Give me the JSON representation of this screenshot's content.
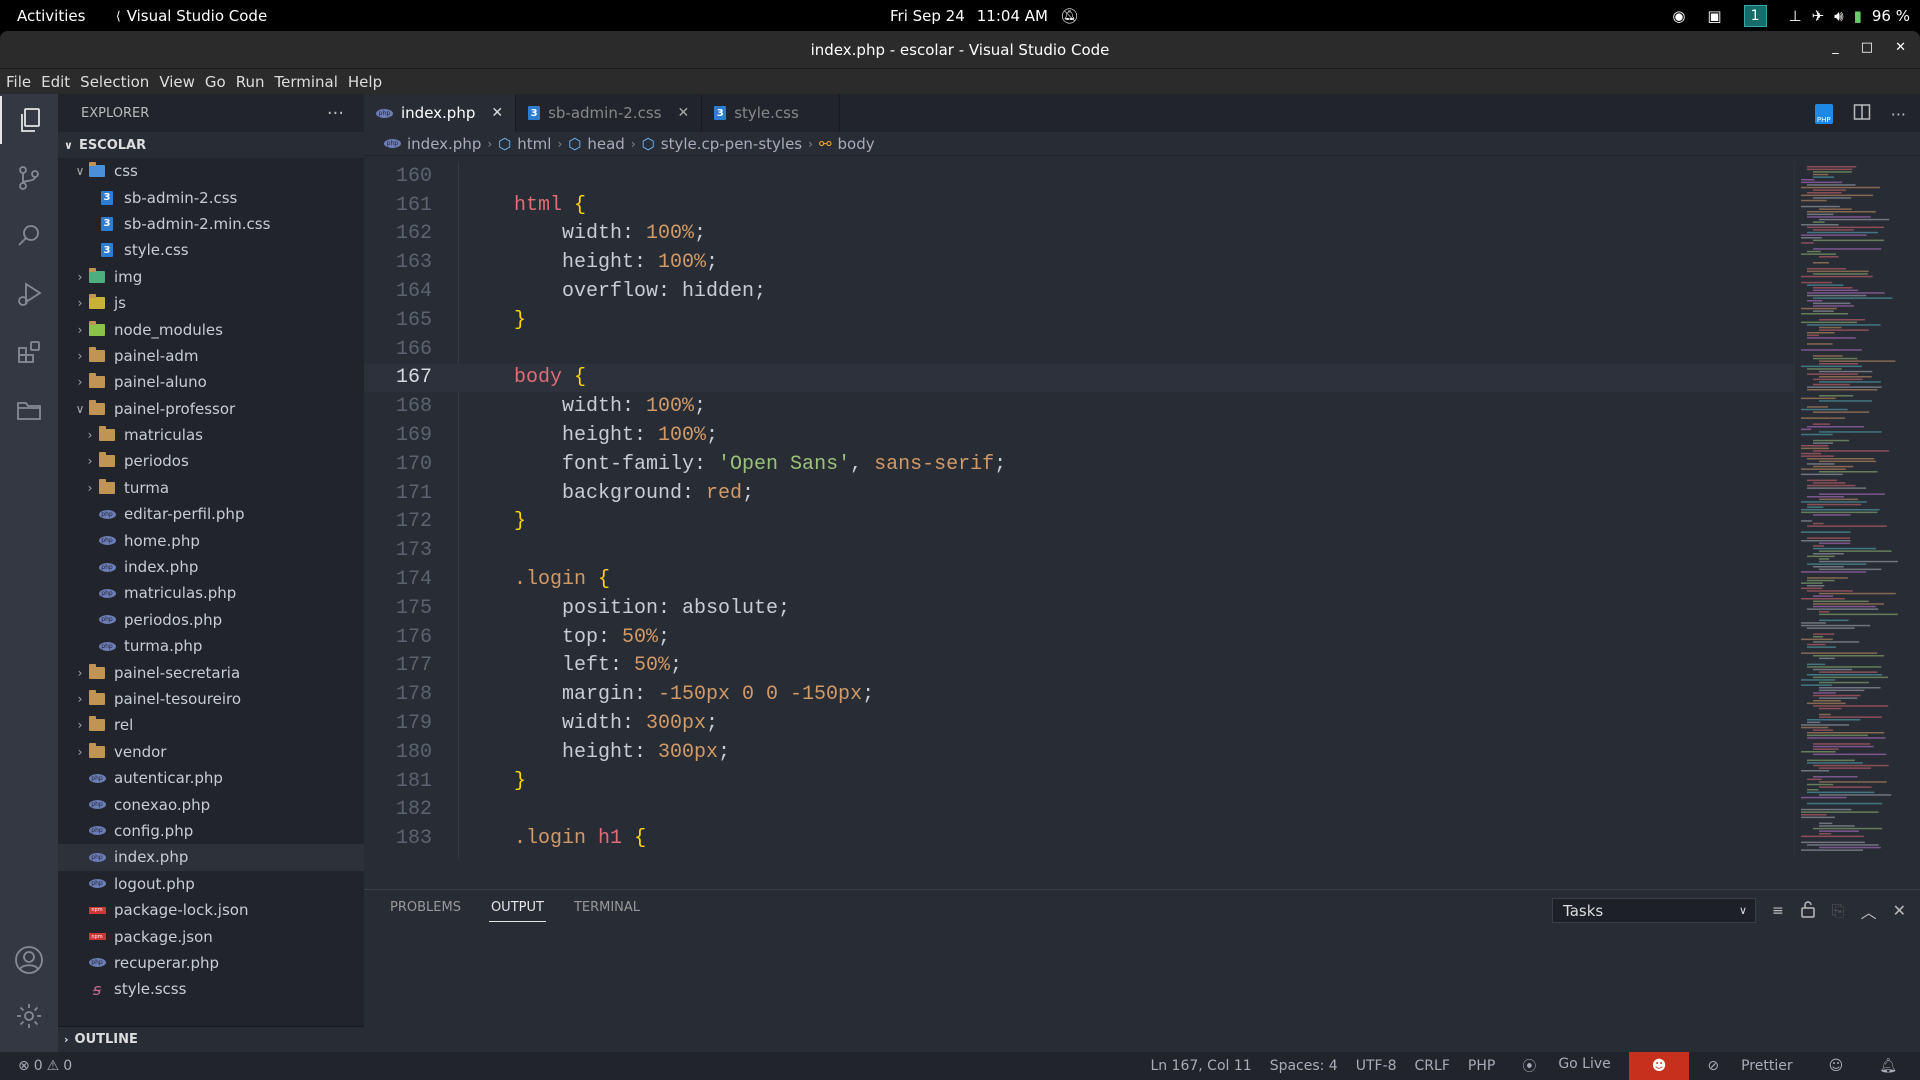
{
  "topbar": {
    "activities": "Activities",
    "app_name": "Visual Studio Code",
    "date": "Fri Sep 24",
    "time": "11:04 AM",
    "workspace": "1",
    "battery": "96 %"
  },
  "window": {
    "title": "index.php - escolar - Visual Studio Code",
    "controls": {
      "minimize": "_",
      "maximize": "□",
      "close": "✕"
    }
  },
  "menu": [
    "File",
    "Edit",
    "Selection",
    "View",
    "Go",
    "Run",
    "Terminal",
    "Help"
  ],
  "explorer": {
    "title": "EXPLORER",
    "more": "···",
    "root": "ESCOLAR",
    "outline": "OUTLINE",
    "tree": [
      {
        "label": "css",
        "type": "css-folder",
        "depth": 1,
        "expanded": true
      },
      {
        "label": "sb-admin-2.css",
        "type": "css",
        "depth": 2
      },
      {
        "label": "sb-admin-2.min.css",
        "type": "css",
        "depth": 2
      },
      {
        "label": "style.css",
        "type": "css",
        "depth": 2
      },
      {
        "label": "img",
        "type": "folder",
        "depth": 1,
        "expanded": false
      },
      {
        "label": "js",
        "type": "folder",
        "depth": 1,
        "expanded": false
      },
      {
        "label": "node_modules",
        "type": "folder",
        "depth": 1,
        "expanded": false
      },
      {
        "label": "painel-adm",
        "type": "folder",
        "depth": 1,
        "expanded": false
      },
      {
        "label": "painel-aluno",
        "type": "folder",
        "depth": 1,
        "expanded": false
      },
      {
        "label": "painel-professor",
        "type": "folder",
        "depth": 1,
        "expanded": true
      },
      {
        "label": "matriculas",
        "type": "folder",
        "depth": 2,
        "expanded": false
      },
      {
        "label": "periodos",
        "type": "folder",
        "depth": 2,
        "expanded": false
      },
      {
        "label": "turma",
        "type": "folder",
        "depth": 2,
        "expanded": false
      },
      {
        "label": "editar-perfil.php",
        "type": "php",
        "depth": 2
      },
      {
        "label": "home.php",
        "type": "php",
        "depth": 2
      },
      {
        "label": "index.php",
        "type": "php",
        "depth": 2
      },
      {
        "label": "matriculas.php",
        "type": "php",
        "depth": 2
      },
      {
        "label": "periodos.php",
        "type": "php",
        "depth": 2
      },
      {
        "label": "turma.php",
        "type": "php",
        "depth": 2
      },
      {
        "label": "painel-secretaria",
        "type": "folder",
        "depth": 1,
        "expanded": false
      },
      {
        "label": "painel-tesoureiro",
        "type": "folder",
        "depth": 1,
        "expanded": false
      },
      {
        "label": "rel",
        "type": "folder",
        "depth": 1,
        "expanded": false
      },
      {
        "label": "vendor",
        "type": "folder",
        "depth": 1,
        "expanded": false
      },
      {
        "label": "autenticar.php",
        "type": "php",
        "depth": 1
      },
      {
        "label": "conexao.php",
        "type": "php",
        "depth": 1
      },
      {
        "label": "config.php",
        "type": "php",
        "depth": 1
      },
      {
        "label": "index.php",
        "type": "php",
        "depth": 1,
        "selected": true
      },
      {
        "label": "logout.php",
        "type": "php",
        "depth": 1
      },
      {
        "label": "package-lock.json",
        "type": "npm",
        "depth": 1
      },
      {
        "label": "package.json",
        "type": "npm",
        "depth": 1
      },
      {
        "label": "recuperar.php",
        "type": "php",
        "depth": 1
      },
      {
        "label": "style.scss",
        "type": "scss",
        "depth": 1
      }
    ]
  },
  "tabs": [
    {
      "label": "index.php",
      "type": "php",
      "active": true,
      "close": "✕"
    },
    {
      "label": "sb-admin-2.css",
      "type": "css",
      "active": false,
      "close": "✕"
    },
    {
      "label": "style.css",
      "type": "css",
      "active": false,
      "close": ""
    }
  ],
  "breadcrumb": [
    "index.php",
    "html",
    "head",
    "style.cp-pen-styles",
    "body"
  ],
  "code": {
    "current_line": 167,
    "lines": [
      {
        "n": "160",
        "tokens": []
      },
      {
        "n": "161",
        "tokens": [
          [
            "sel",
            "html"
          ],
          [
            "p",
            " "
          ],
          [
            "b",
            "{"
          ]
        ]
      },
      {
        "n": "162",
        "tokens": [
          [
            "p",
            "    width: "
          ],
          [
            "num",
            "100%"
          ],
          [
            "p",
            ";"
          ]
        ]
      },
      {
        "n": "163",
        "tokens": [
          [
            "p",
            "    height: "
          ],
          [
            "num",
            "100%"
          ],
          [
            "p",
            ";"
          ]
        ]
      },
      {
        "n": "164",
        "tokens": [
          [
            "p",
            "    overflow: hidden;"
          ]
        ]
      },
      {
        "n": "165",
        "tokens": [
          [
            "b",
            "}"
          ]
        ]
      },
      {
        "n": "166",
        "tokens": []
      },
      {
        "n": "167",
        "tokens": [
          [
            "sel",
            "body"
          ],
          [
            "p",
            " "
          ],
          [
            "b",
            "{"
          ]
        ]
      },
      {
        "n": "168",
        "tokens": [
          [
            "p",
            "    width: "
          ],
          [
            "num",
            "100%"
          ],
          [
            "p",
            ";"
          ]
        ]
      },
      {
        "n": "169",
        "tokens": [
          [
            "p",
            "    height: "
          ],
          [
            "num",
            "100%"
          ],
          [
            "p",
            ";"
          ]
        ]
      },
      {
        "n": "170",
        "tokens": [
          [
            "p",
            "    font-family: "
          ],
          [
            "str",
            "'Open Sans'"
          ],
          [
            "p",
            ", "
          ],
          [
            "num",
            "sans-serif"
          ],
          [
            "p",
            ";"
          ]
        ]
      },
      {
        "n": "171",
        "tokens": [
          [
            "p",
            "    background: "
          ],
          [
            "num",
            "red"
          ],
          [
            "p",
            ";"
          ]
        ]
      },
      {
        "n": "172",
        "tokens": [
          [
            "b",
            "}"
          ]
        ]
      },
      {
        "n": "173",
        "tokens": []
      },
      {
        "n": "174",
        "tokens": [
          [
            "cls",
            ".login"
          ],
          [
            "p",
            " "
          ],
          [
            "b",
            "{"
          ]
        ]
      },
      {
        "n": "175",
        "tokens": [
          [
            "p",
            "    position: absolute;"
          ]
        ]
      },
      {
        "n": "176",
        "tokens": [
          [
            "p",
            "    top: "
          ],
          [
            "num",
            "50%"
          ],
          [
            "p",
            ";"
          ]
        ]
      },
      {
        "n": "177",
        "tokens": [
          [
            "p",
            "    left: "
          ],
          [
            "num",
            "50%"
          ],
          [
            "p",
            ";"
          ]
        ]
      },
      {
        "n": "178",
        "tokens": [
          [
            "p",
            "    margin: "
          ],
          [
            "num",
            "-150px 0 0 -150px"
          ],
          [
            "p",
            ";"
          ]
        ]
      },
      {
        "n": "179",
        "tokens": [
          [
            "p",
            "    width: "
          ],
          [
            "num",
            "300px"
          ],
          [
            "p",
            ";"
          ]
        ]
      },
      {
        "n": "180",
        "tokens": [
          [
            "p",
            "    height: "
          ],
          [
            "num",
            "300px"
          ],
          [
            "p",
            ";"
          ]
        ]
      },
      {
        "n": "181",
        "tokens": [
          [
            "b",
            "}"
          ]
        ]
      },
      {
        "n": "182",
        "tokens": []
      },
      {
        "n": "183",
        "tokens": [
          [
            "cls",
            ".login"
          ],
          [
            "p",
            " "
          ],
          [
            "sel",
            "h1"
          ],
          [
            "p",
            " "
          ],
          [
            "b",
            "{"
          ]
        ]
      }
    ]
  },
  "panel": {
    "tabs": [
      {
        "label": "PROBLEMS",
        "active": false
      },
      {
        "label": "OUTPUT",
        "active": true
      },
      {
        "label": "TERMINAL",
        "active": false
      }
    ],
    "dropdown_value": "Tasks"
  },
  "status": {
    "errors": "0",
    "warnings": "0",
    "position": "Ln 167, Col 11",
    "spaces": "Spaces: 4",
    "encoding": "UTF-8",
    "eol": "CRLF",
    "language": "PHP",
    "golive": "Go Live",
    "prettier": "Prettier"
  },
  "colors": {
    "accent_workspace": "#176b6b",
    "copilot_badge": "#c5311c"
  }
}
